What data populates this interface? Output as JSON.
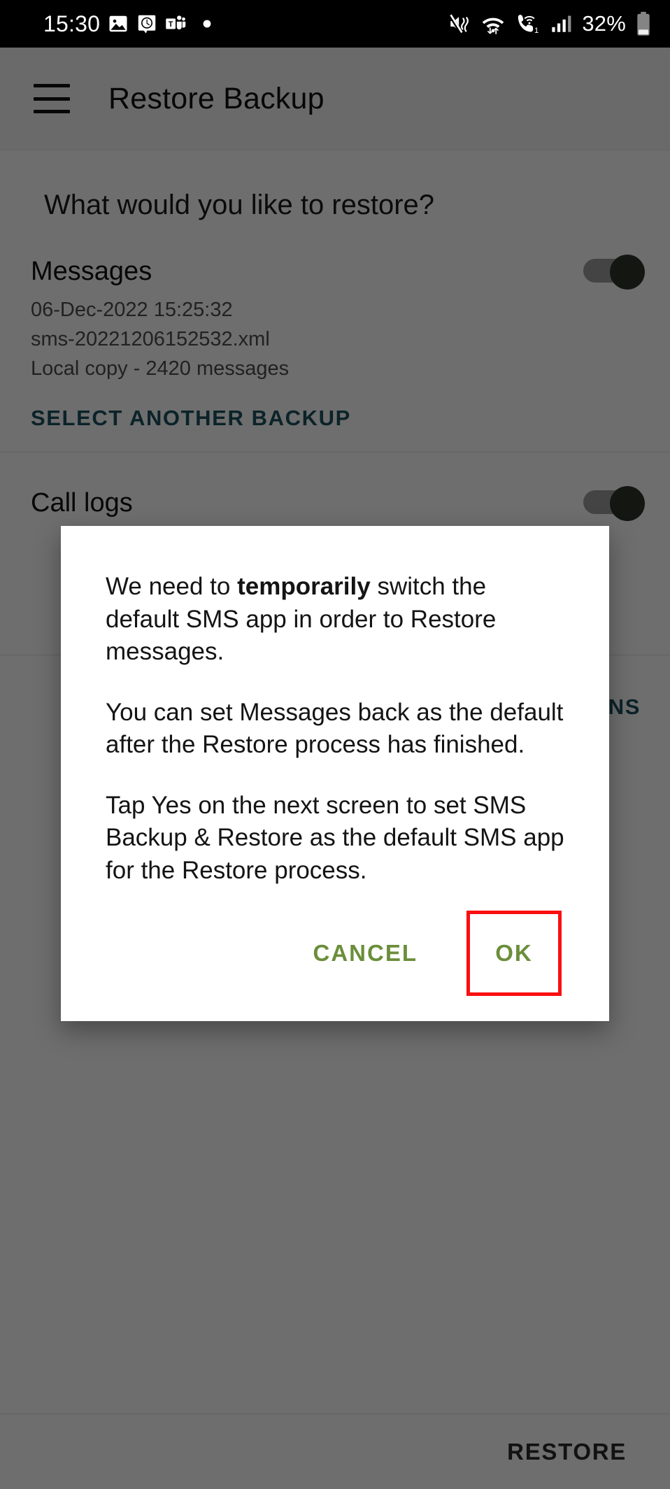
{
  "statusbar": {
    "time": "15:30",
    "icons_left": [
      "gallery-icon",
      "alarm-clock-icon",
      "microsoft-teams-icon",
      "notification-dot-icon"
    ],
    "icons_right": [
      "mute-vibrate-icon",
      "wifi-transfer-icon",
      "wifi-calling-icon",
      "signal-bars-icon"
    ],
    "battery_percent": "32%",
    "battery_icon": "battery-icon"
  },
  "appbar": {
    "menu_icon": "hamburger-menu-icon",
    "title": "Restore Backup"
  },
  "content": {
    "question": "What would you like to restore?",
    "messages_row": {
      "title": "Messages",
      "timestamp": "06-Dec-2022 15:25:32",
      "filename": "sms-20221206152532.xml",
      "details": "Local copy - 2420 messages",
      "select_another_label": "SELECT ANOTHER BACKUP",
      "toggle_state": "on"
    },
    "calls_row": {
      "title": "Call logs",
      "toggle_state": "on"
    },
    "advanced_row": {
      "label": "ADVANCED OPTIONS"
    }
  },
  "bottombar": {
    "restore_label": "RESTORE"
  },
  "dialog": {
    "paragraph1_before": "We need to ",
    "paragraph1_bold": "temporarily",
    "paragraph1_after": " switch the default SMS app in order to Restore messages.",
    "paragraph2": "You can set Messages back as the default after the Restore process has finished.",
    "paragraph3": "Tap Yes on the next screen to set SMS Backup & Restore as the default SMS app for the Restore process.",
    "cancel_label": "CANCEL",
    "ok_label": "OK"
  },
  "colors": {
    "accent_link": "#19505f",
    "dialog_button": "#6b8e3b",
    "highlight_box": "#fa0f10",
    "status_bar": "#000000"
  }
}
